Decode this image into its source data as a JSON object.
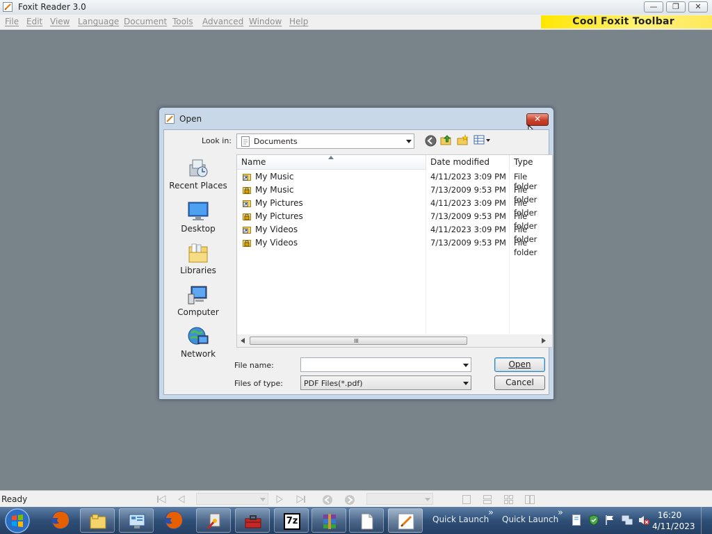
{
  "window": {
    "title": "Foxit Reader 3.0"
  },
  "caption_buttons": {
    "minimize": "—",
    "maximize": "❐",
    "close": "✕"
  },
  "menu": [
    "File",
    "Edit",
    "View",
    "Language",
    "Document",
    "Tools",
    "Advanced",
    "Window",
    "Help"
  ],
  "cool_toolbar": "Cool Foxit Toolbar",
  "dialog": {
    "title": "Open",
    "close": "✕",
    "look_in_label": "Look in:",
    "look_in_value": "Documents",
    "places": [
      "Recent Places",
      "Desktop",
      "Libraries",
      "Computer",
      "Network"
    ],
    "columns": {
      "name": "Name",
      "date": "Date modified",
      "type": "Type"
    },
    "files": [
      {
        "name": "My Music",
        "date": "4/11/2023 3:09 PM",
        "type": "File folder",
        "icon": "shortcut-folder-icon"
      },
      {
        "name": "My Music",
        "date": "7/13/2009 9:53 PM",
        "type": "File folder",
        "icon": "locked-folder-icon"
      },
      {
        "name": "My Pictures",
        "date": "4/11/2023 3:09 PM",
        "type": "File folder",
        "icon": "shortcut-folder-icon"
      },
      {
        "name": "My Pictures",
        "date": "7/13/2009 9:53 PM",
        "type": "File folder",
        "icon": "locked-folder-icon"
      },
      {
        "name": "My Videos",
        "date": "4/11/2023 3:09 PM",
        "type": "File folder",
        "icon": "shortcut-folder-icon"
      },
      {
        "name": "My Videos",
        "date": "7/13/2009 9:53 PM",
        "type": "File folder",
        "icon": "locked-folder-icon"
      }
    ],
    "file_name_label": "File name:",
    "file_name_value": "",
    "file_type_label": "Files of type:",
    "file_type_value": "PDF Files(*.pdf)",
    "open_button": "Open",
    "cancel_button": "Cancel"
  },
  "status": {
    "text": "Ready"
  },
  "taskbar": {
    "quick_launch_1": "Quick Launch",
    "quick_launch_2": "Quick Launch",
    "chevron": "»",
    "time": "16:20",
    "date": "4/11/2023",
    "seven_zip": "7z"
  },
  "colors": {
    "accent": "#ffe600",
    "taskbar": "#2f4f77",
    "workspace": "#79838a",
    "close": "#c8412a"
  }
}
